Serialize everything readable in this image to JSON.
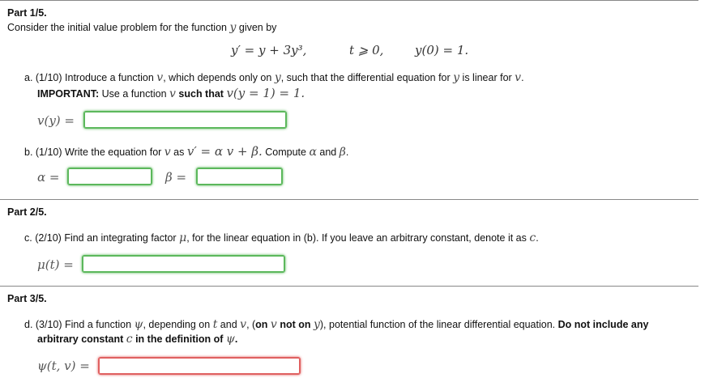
{
  "part1": {
    "title": "Part 1/5.",
    "intro_prefix": "Consider the initial value problem for the function ",
    "intro_var": "y",
    "intro_suffix": " given by",
    "equation": {
      "ode": "y′ = y + 3y³,",
      "domain": "t ⩾ 0,",
      "ic": "y(0) = 1."
    },
    "a": {
      "line1_prefix": "a. (1/10) Introduce a function ",
      "line1_v": "v",
      "line1_mid": ", which depends only on ",
      "line1_y": "y",
      "line1_mid2": ", such that the differential equation for ",
      "line1_y2": "y",
      "line1_mid3": " is linear for ",
      "line1_v2": "v",
      "line1_end": ".",
      "line2_important": "IMPORTANT:",
      "line2_mid": " Use a function ",
      "line2_v": "v",
      "line2_bold": " such that ",
      "line2_math": "v(y = 1) = 1.",
      "label": "v(y) =",
      "input_value": ""
    },
    "b": {
      "text_prefix": "b. (1/10) Write the equation for ",
      "text_v": "v",
      "text_as": " as ",
      "text_math": "v′ = α v + β.",
      "text_compute": " Compute ",
      "text_alpha": "α",
      "text_and": " and ",
      "text_beta": "β",
      "text_end": ".",
      "alpha_label": "α =",
      "beta_label": "β =",
      "alpha_value": "",
      "beta_value": ""
    }
  },
  "part2": {
    "title": "Part 2/5.",
    "c": {
      "text_prefix": "c. (2/10) Find an integrating factor ",
      "text_mu": "μ",
      "text_mid": ", for the linear equation in (b). If you leave an arbitrary constant, denote it as ",
      "text_c": "c",
      "text_end": ".",
      "label": "μ(t) =",
      "input_value": ""
    }
  },
  "part3": {
    "title": "Part 3/5.",
    "d": {
      "line1_prefix": "d. (3/10) Find a function ",
      "psi": "ψ",
      "line1_mid": ", depending on ",
      "t": "t",
      "line1_and": " and ",
      "v": "v",
      "line1_paren": ", (",
      "on_bold": "on ",
      "v2": "v",
      "not_on_bold": " not on ",
      "y": "y",
      "line1_rest": "), potential function of the linear differential equation. ",
      "line1_bold": "Do not include any",
      "line2_bold": "arbitrary constant ",
      "c": "c",
      "line2_bold2": " in the definition of ",
      "psi2": "ψ",
      "line2_end": ".",
      "label": "ψ(t, v) =",
      "input_value": ""
    }
  }
}
